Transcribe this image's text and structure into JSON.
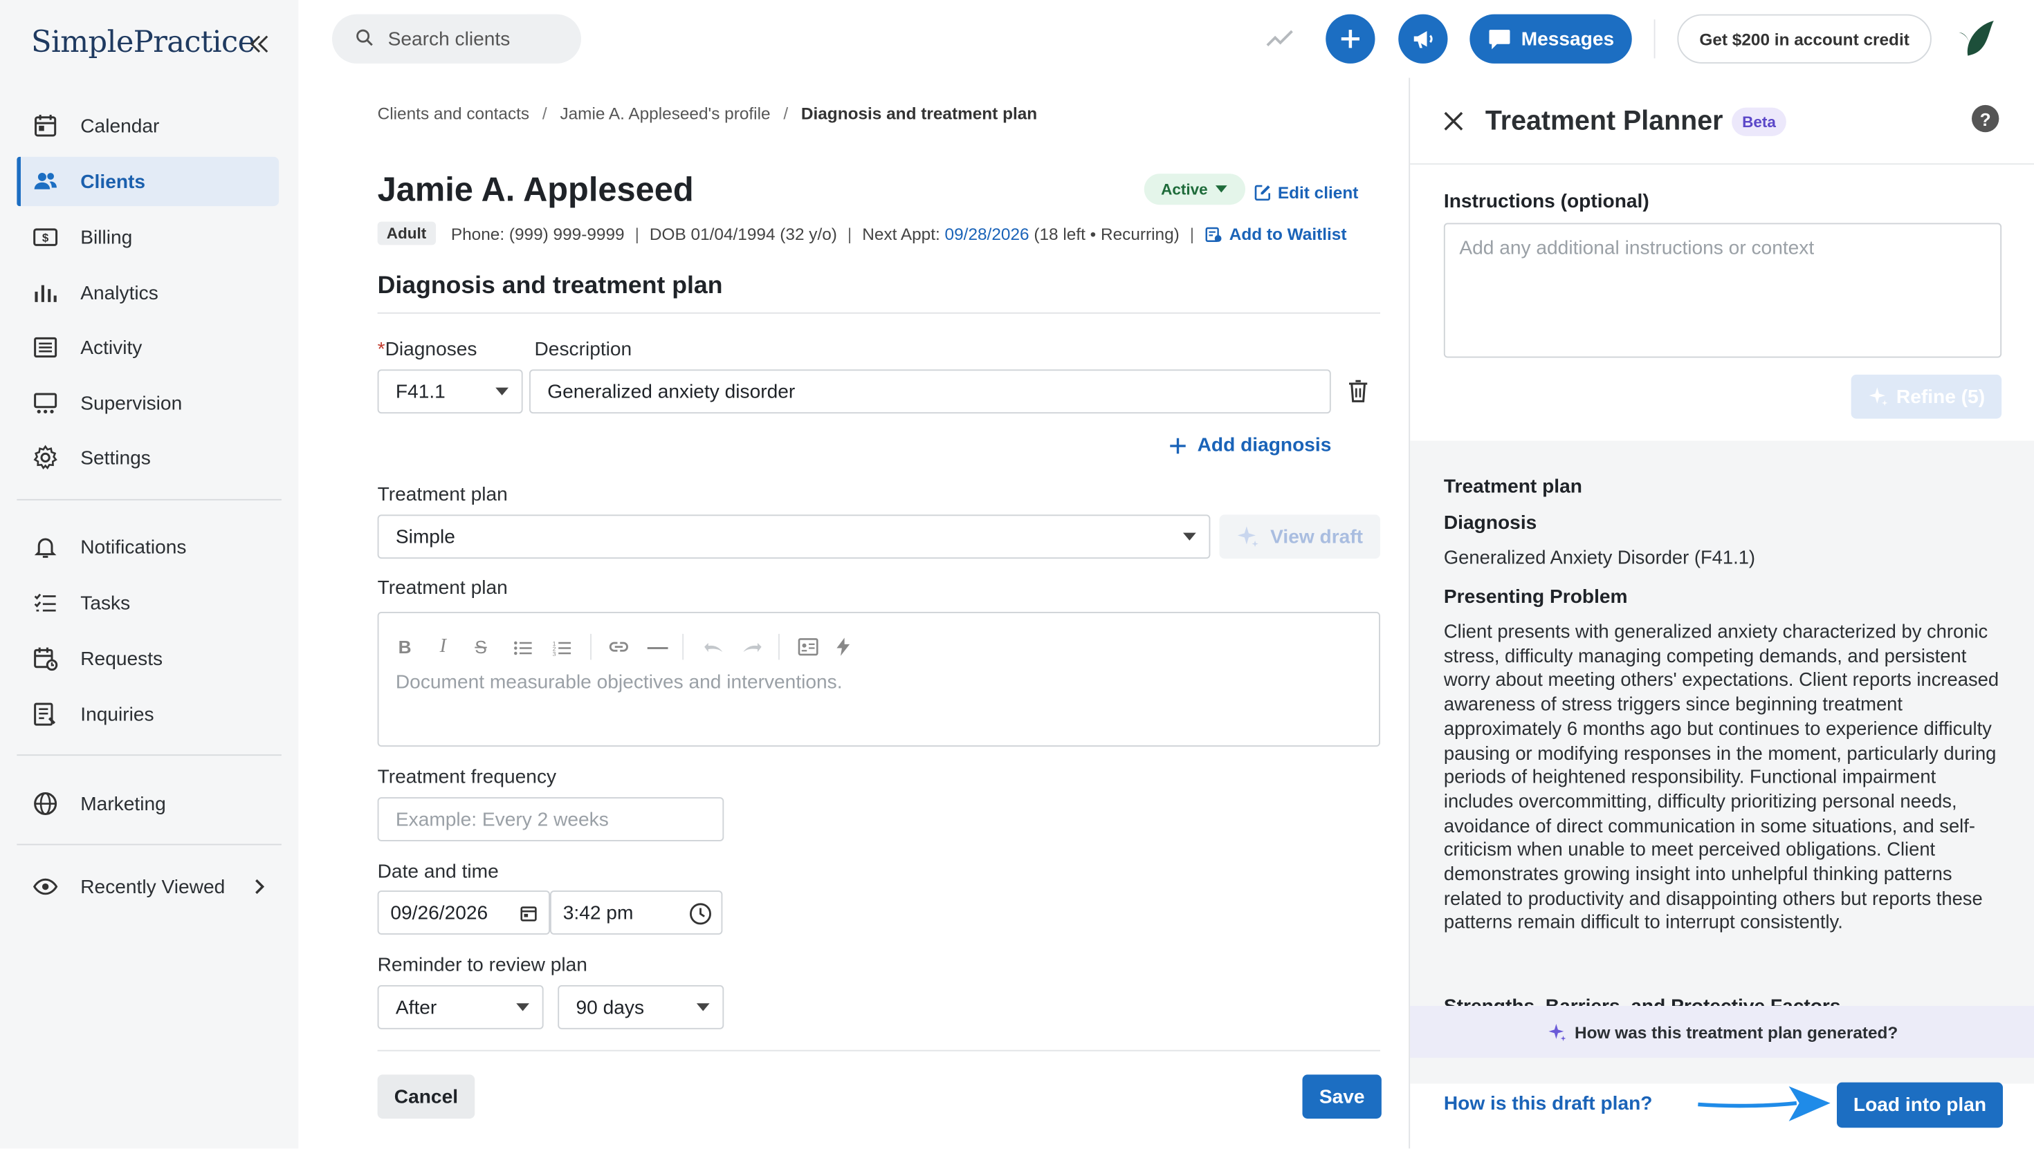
{
  "sidebar": {
    "logo": "SimplePractice",
    "items": [
      {
        "label": "Calendar",
        "icon": "calendar-icon"
      },
      {
        "label": "Clients",
        "icon": "users-icon"
      },
      {
        "label": "Billing",
        "icon": "billing-icon"
      },
      {
        "label": "Analytics",
        "icon": "analytics-icon"
      },
      {
        "label": "Activity",
        "icon": "activity-icon"
      },
      {
        "label": "Supervision",
        "icon": "supervision-icon"
      },
      {
        "label": "Settings",
        "icon": "gear-icon"
      },
      {
        "label": "Notifications",
        "icon": "bell-icon"
      },
      {
        "label": "Tasks",
        "icon": "tasks-icon"
      },
      {
        "label": "Requests",
        "icon": "requests-icon"
      },
      {
        "label": "Inquiries",
        "icon": "inquiries-icon"
      },
      {
        "label": "Marketing",
        "icon": "globe-icon"
      },
      {
        "label": "Recently Viewed",
        "icon": "eye-icon"
      }
    ],
    "active_item": "Clients"
  },
  "topbar": {
    "search_placeholder": "Search clients",
    "messages_label": "Messages",
    "credit_label": "Get $200 in account credit"
  },
  "breadcrumb": {
    "items": [
      "Clients and contacts",
      "Jamie A. Appleseed's profile",
      "Diagnosis and treatment plan"
    ],
    "sep": "/"
  },
  "client": {
    "name": "Jamie A. Appleseed",
    "status": "Active",
    "edit_label": "Edit client",
    "tag": "Adult",
    "phone": "Phone: (999) 999-9999",
    "dob": "DOB 01/04/1994 (32 y/o)",
    "next_appt_prefix": "Next Appt:",
    "next_appt_date": "09/28/2026",
    "next_appt_suffix": "(18 left • Recurring)",
    "waitlist_label": "Add to Waitlist"
  },
  "form": {
    "section_title": "Diagnosis and treatment plan",
    "diagnoses_label": "Diagnoses",
    "required_mark": "*",
    "description_label": "Description",
    "diagnosis_code": "F41.1",
    "diagnosis_description": "Generalized anxiety disorder",
    "add_diagnosis_label": "Add diagnosis",
    "plan_type_label": "Treatment plan",
    "plan_type_value": "Simple",
    "view_draft_label": "View draft",
    "plan_label": "Treatment plan",
    "plan_placeholder": "Document measurable objectives and interventions.",
    "frequency_label": "Treatment frequency",
    "frequency_placeholder": "Example: Every 2 weeks",
    "datetime_label": "Date and time",
    "date_value": "09/26/2026",
    "time_value": "3:42 pm",
    "reminder_label": "Reminder to review plan",
    "reminder_when": "After",
    "reminder_period": "90 days",
    "cancel_label": "Cancel",
    "save_label": "Save"
  },
  "planner": {
    "title": "Treatment Planner",
    "beta": "Beta",
    "help": "?",
    "instructions_label": "Instructions (optional)",
    "instructions_placeholder": "Add any additional instructions or context",
    "refine_label": "Refine (5)",
    "draft": {
      "heading": "Treatment plan",
      "diagnosis_heading": "Diagnosis",
      "diagnosis_text": "Generalized Anxiety Disorder (F41.1)",
      "problem_heading": "Presenting Problem",
      "problem_text": "Client presents with generalized anxiety characterized by chronic stress, difficulty managing competing demands, and persistent worry about meeting others' expectations. Client reports increased awareness of stress triggers since beginning treatment approximately 6 months ago but continues to experience difficulty pausing or modifying responses in the moment, particularly during periods of heightened responsibility. Functional impairment includes overcommitting, difficulty prioritizing personal needs, avoidance of direct communication in some situations, and self-criticism when unable to meet perceived obligations. Client demonstrates growing insight into unhelpful thinking patterns related to productivity and disappointing others but reports these patterns remain difficult to interrupt consistently.",
      "next_heading": "Strengths, Barriers, and Protective Factors"
    },
    "how_generated": "How was this treatment plan generated?",
    "feedback_question": "How is this draft plan?",
    "load_label": "Load into plan"
  }
}
